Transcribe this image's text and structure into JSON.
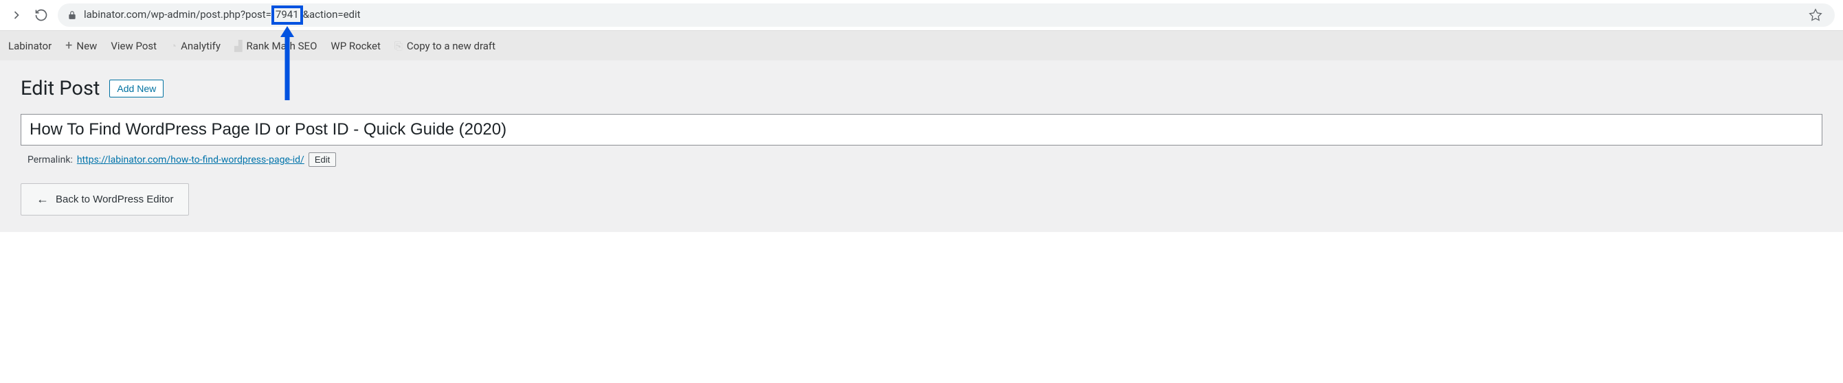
{
  "browser": {
    "url_prefix": "labinator.com/wp-admin/post.php?post=",
    "url_highlighted": "7941",
    "url_suffix": "&action=edit"
  },
  "toolbar": {
    "site_name": "Labinator",
    "new_label": "New",
    "view_post_label": "View Post",
    "analytify_label": "Analytify",
    "rank_math_label": "Rank Math SEO",
    "wp_rocket_label": "WP Rocket",
    "copy_draft_label": "Copy to a new draft"
  },
  "page": {
    "title": "Edit Post",
    "add_new_label": "Add New",
    "post_title": "How To Find WordPress Page ID or Post ID - Quick Guide (2020)",
    "permalink_label": "Permalink:",
    "permalink_url": "https://labinator.com/how-to-find-wordpress-page-id/",
    "edit_label": "Edit",
    "back_label": "Back to WordPress Editor"
  },
  "annotation": {
    "highlight_color": "#0052e0"
  }
}
